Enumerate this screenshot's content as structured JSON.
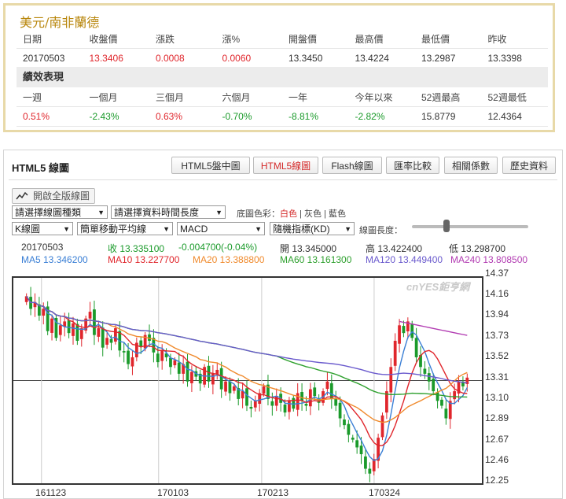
{
  "quote": {
    "title": "美元/南非蘭德",
    "headers": [
      "日期",
      "收盤價",
      "漲跌",
      "漲%",
      "開盤價",
      "最高價",
      "最低價",
      "昨收"
    ],
    "values": [
      "20170503",
      "13.3406",
      "0.0008",
      "0.0060",
      "13.3450",
      "13.4224",
      "13.2987",
      "13.3398"
    ],
    "perf_title": "績效表現",
    "perf_headers": [
      "一週",
      "一個月",
      "三個月",
      "六個月",
      "一年",
      "今年以來",
      "52週最高",
      "52週最低"
    ],
    "perf_values": [
      "0.51%",
      "-2.43%",
      "0.63%",
      "-0.70%",
      "-8.81%",
      "-2.82%",
      "15.8779",
      "12.4364"
    ]
  },
  "chart_panel": {
    "title": "HTML5 線圖",
    "tabs": [
      "HTML5盤中圖",
      "HTML5線圖",
      "Flash線圖",
      "匯率比較",
      "相關係數",
      "歷史資料"
    ],
    "active_tab": "HTML5線圖",
    "full_button": "開啟全版線圖",
    "selects": {
      "chart_type": "請選擇線圖種類",
      "time_range": "請選擇資料時間長度",
      "kline": "K線圖",
      "ma_type": "簡單移動平均線",
      "indicator": "MACD",
      "random_indicator": "隨機指標(KD)"
    },
    "bg_label": "底圖色彩：",
    "bg_options": [
      "白色",
      "灰色",
      "藍色"
    ],
    "bg_separator": " | ",
    "length_label": "線圖長度：",
    "slider_value": 0.3
  },
  "info_row1": {
    "date": "20170503",
    "close": "收 13.335100",
    "change": "-0.004700(-0.04%)",
    "open": "開 13.345000",
    "high": "高 13.422400",
    "low": "低 13.298700"
  },
  "info_row2": {
    "ma5": "MA5 13.346200",
    "ma10": "MA10 13.227700",
    "ma20": "MA20 13.388800",
    "ma60": "MA60 13.161300",
    "ma120": "MA120 13.449400",
    "ma240": "MA240 13.808500"
  },
  "colors": {
    "up": "#e0262c",
    "down": "#1a9a2a",
    "ma5": "#3a7fd5",
    "ma10": "#e0262c",
    "ma20": "#f08a2c",
    "ma60": "#2ea02e",
    "ma120": "#6a5acd",
    "ma240": "#b23cb2"
  },
  "watermark": "cnYES鉅亨網",
  "chart_data": {
    "type": "candlestick",
    "title": "",
    "y_ticks": [
      "14.37",
      "14.16",
      "13.94",
      "13.73",
      "13.52",
      "13.31",
      "13.10",
      "12.89",
      "12.67",
      "12.46",
      "12.25"
    ],
    "x_ticks": [
      "161123",
      "170103",
      "170213",
      "170324"
    ],
    "ylim": [
      12.25,
      14.37
    ],
    "close_series": [
      14.18,
      14.05,
      14.12,
      13.98,
      14.05,
      13.82,
      13.95,
      13.75,
      13.88,
      13.92,
      13.8,
      13.9,
      13.72,
      13.85,
      13.95,
      14.02,
      13.78,
      13.85,
      13.65,
      13.75,
      13.7,
      13.85,
      13.62,
      13.6,
      13.48,
      13.55,
      13.7,
      13.66,
      13.78,
      13.72,
      13.6,
      13.5,
      13.62,
      13.55,
      13.45,
      13.52,
      13.38,
      13.48,
      13.3,
      13.4,
      13.35,
      13.28,
      13.45,
      13.3,
      13.38,
      13.42,
      13.22,
      13.3,
      13.18,
      13.25,
      13.12,
      13.2,
      13.05,
      13.02,
      13.1,
      13.18,
      13.25,
      13.12,
      13.05,
      13.15,
      13.08,
      12.98,
      13.1,
      13.02,
      13.18,
      13.1,
      13.05,
      13.22,
      13.15,
      13.08,
      13.2,
      13.3,
      13.12,
      13.05,
      12.92,
      12.85,
      12.75,
      12.7,
      12.62,
      12.55,
      12.4,
      12.35,
      12.5,
      12.72,
      12.95,
      13.2,
      13.45,
      13.72,
      13.88,
      13.8,
      13.92,
      13.75,
      13.55,
      13.45,
      13.38,
      13.3,
      13.2,
      13.1,
      13.05,
      12.92,
      13.1,
      13.2,
      13.3,
      13.25,
      13.34
    ]
  }
}
